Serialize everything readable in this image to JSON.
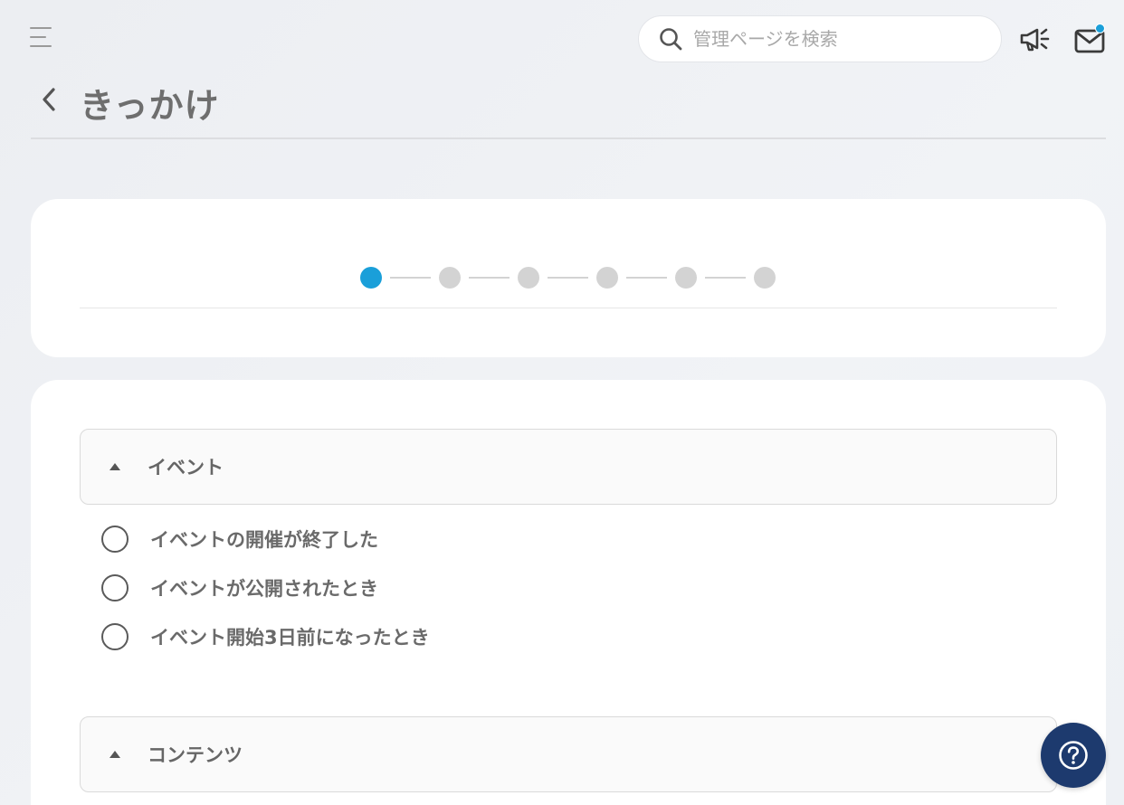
{
  "header": {
    "search": {
      "placeholder": "管理ページを検索",
      "value": ""
    },
    "mail": {
      "has_notification": true,
      "notification_color": "#1a9fd9"
    }
  },
  "page": {
    "title": "きっかけ"
  },
  "stepper": {
    "total_steps": 6,
    "current_step": 1,
    "active_color": "#1a9fd9",
    "inactive_color": "#d3d3d3"
  },
  "sections": [
    {
      "label": "イベント",
      "expanded": true,
      "options": [
        {
          "label": "イベントの開催が終了した",
          "selected": false
        },
        {
          "label": "イベントが公開されたとき",
          "selected": false
        },
        {
          "label": "イベント開始3日前になったとき",
          "selected": false
        }
      ]
    },
    {
      "label": "コンテンツ",
      "expanded": true,
      "options": []
    }
  ],
  "icons": {
    "menu": "hamburger-menu-icon",
    "search": "search-icon",
    "announcement": "megaphone-icon",
    "mail": "mail-icon",
    "back": "chevron-left-icon",
    "help": "help-question-icon"
  },
  "colors": {
    "accent": "#1a9fd9",
    "help_button": "#1d3a6e"
  }
}
